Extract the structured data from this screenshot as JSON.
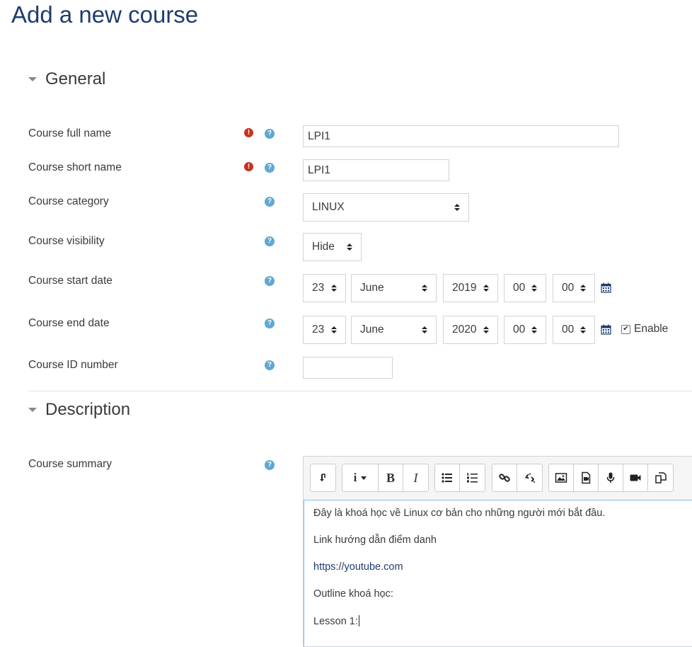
{
  "page": {
    "title": "Add a new course"
  },
  "sections": {
    "general": "General",
    "description": "Description"
  },
  "fields": {
    "full_name": {
      "label": "Course full name",
      "value": "LPI1"
    },
    "short_name": {
      "label": "Course short name",
      "value": "LPI1"
    },
    "category": {
      "label": "Course category",
      "value": "LINUX"
    },
    "visibility": {
      "label": "Course visibility",
      "value": "Hide"
    },
    "start_date": {
      "label": "Course start date",
      "day": "23",
      "month": "June",
      "year": "2019",
      "hour": "00",
      "minute": "00"
    },
    "end_date": {
      "label": "Course end date",
      "day": "23",
      "month": "June",
      "year": "2020",
      "hour": "00",
      "minute": "00",
      "enable_label": "Enable",
      "enabled": true
    },
    "id_number": {
      "label": "Course ID number",
      "value": ""
    },
    "summary": {
      "label": "Course summary"
    }
  },
  "icons": {
    "required": "required-icon",
    "help": "help-icon",
    "calendar": "calendar-icon",
    "required_glyph": "!",
    "help_glyph": "?",
    "check_glyph": "✔"
  },
  "colors": {
    "title": "#1f3c6e",
    "required": "#ca3120",
    "help": "#5fa8d3",
    "link": "#1f3c6e"
  },
  "editor": {
    "toolbar": [
      "show-more-icon",
      "paragraph-styles-icon",
      "bold-icon",
      "italic-icon",
      "unordered-list-icon",
      "ordered-list-icon",
      "link-icon",
      "unlink-icon",
      "image-icon",
      "media-icon",
      "record-audio-icon",
      "record-video-icon",
      "manage-files-icon"
    ],
    "labels": {
      "styles": "i",
      "bold": "B",
      "italic": "I"
    },
    "content": [
      "Đây là khoá học về Linux cơ bản cho những người mới bắt đầu.",
      "Link hướng dẫn điểm danh",
      "https://youtube.com",
      "Outline khoá học:",
      "Lesson 1:"
    ]
  }
}
